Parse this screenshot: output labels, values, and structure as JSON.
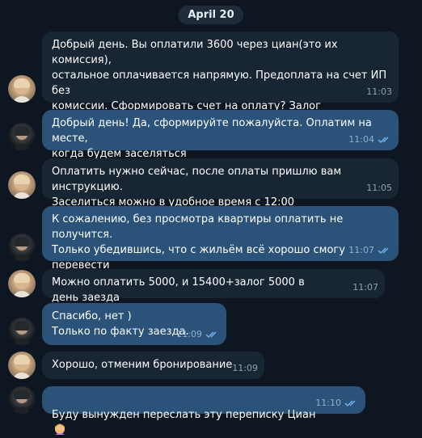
{
  "date_label": "April 20",
  "messages": [
    {
      "dir": "in",
      "text": "Добрый день. Вы оплатили 3600 через циан(это их комиссия),\nостальное оплачивается напрямую. Предоплата на счет ИП без\nкомиссии. Сформировать счет на оплату? Залог оплачивается\nотдельно в день заезда",
      "time": "11:03"
    },
    {
      "dir": "out",
      "text": "Добрый день! Да, сформируйте пожалуйста. Оплатим на месте,\nкогда будем заселяться",
      "time": "11:04"
    },
    {
      "dir": "in",
      "text": "Оплатить нужно сейчас, после оплаты пришлю вам инструкцию.\nЗаселиться можно в удобное время с 12:00",
      "time": "11:05"
    },
    {
      "dir": "out",
      "text": "К сожалению, без просмотра квартиры оплатить не получится.\nТолько убедившись, что с жильём всё хорошо смогу перевести\nостаток суммы и залог на месте",
      "time": "11:07"
    },
    {
      "dir": "in",
      "text": "Можно оплатить 5000, и 15400+залог 5000 в день заезда",
      "time": "11:07"
    },
    {
      "dir": "out",
      "text": "Спасибо, нет )\nТолько по факту заезда.",
      "time": "11:09"
    },
    {
      "dir": "in",
      "text": "Хорошо, отменим бронирование",
      "time": "11:09"
    },
    {
      "dir": "out",
      "text": "Буду вынужден переслать эту переписку Циан",
      "time": "11:10",
      "emoji": "woman-facepalming-emoji"
    }
  ],
  "icons": {
    "read_receipt": "double-check-icon",
    "avatar_in": "woman-avatar",
    "avatar_out": "man-avatar"
  },
  "colors": {
    "background": "#0e1621",
    "incoming": "#182533",
    "outgoing": "#2b5278",
    "check": "#6fb1f2"
  }
}
